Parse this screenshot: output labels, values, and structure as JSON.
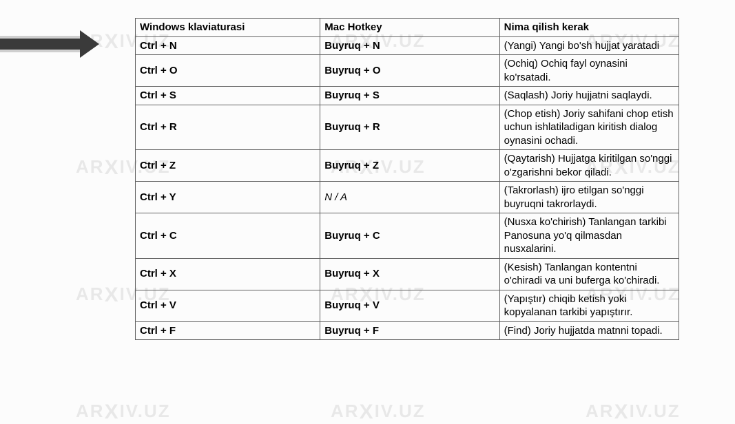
{
  "watermark": "ARXIV.UZ",
  "table": {
    "headers": [
      "Windows klaviaturasi",
      "Mac Hotkey",
      "Nima qilish kerak"
    ],
    "rows": [
      {
        "win": "Ctrl + N",
        "mac": "Buyruq + N",
        "mac_italic": false,
        "desc": "(Yangi) Yangi bo'sh hujjat yaratadi"
      },
      {
        "win": "Ctrl + O",
        "mac": "Buyruq + O",
        "mac_italic": false,
        "desc": "(Ochiq) Ochiq fayl oynasini ko'rsatadi."
      },
      {
        "win": "Ctrl + S",
        "mac": "Buyruq + S",
        "mac_italic": false,
        "desc": "(Saqlash) Joriy hujjatni saqlaydi."
      },
      {
        "win": "Ctrl + R",
        "mac": "Buyruq + R",
        "mac_italic": false,
        "desc": "(Chop etish) Joriy sahifani chop etish uchun ishlatiladigan kiritish dialog oynasini ochadi."
      },
      {
        "win": "Ctrl + Z",
        "mac": "Buyruq + Z",
        "mac_italic": false,
        "desc": "(Qaytarish) Hujjatga kiritilgan so'nggi o'zgarishni bekor qiladi."
      },
      {
        "win": "Ctrl + Y",
        "mac": "N / A",
        "mac_italic": true,
        "desc": "(Takrorlash) ijro etilgan so'nggi buyruqni takrorlaydi."
      },
      {
        "win": "Ctrl + C",
        "mac": "Buyruq + C",
        "mac_italic": false,
        "desc": "(Nusxa ko'chirish) Tanlangan tarkibi Panosuna yo'q qilmasdan nusxalarini."
      },
      {
        "win": "Ctrl + X",
        "mac": "Buyruq + X",
        "mac_italic": false,
        "desc": "(Kesish) Tanlangan kontentni o'chiradi va uni buferga ko'chiradi."
      },
      {
        "win": "Ctrl + V",
        "mac": "Buyruq + V",
        "mac_italic": false,
        "desc": "(Yapıştır) chiqib ketish yoki kopyalanan tarkibi yapıştırır."
      },
      {
        "win": "Ctrl + F",
        "mac": "Buyruq + F",
        "mac_italic": false,
        "desc": "(Find) Joriy hujjatda matnni topadi."
      }
    ]
  }
}
